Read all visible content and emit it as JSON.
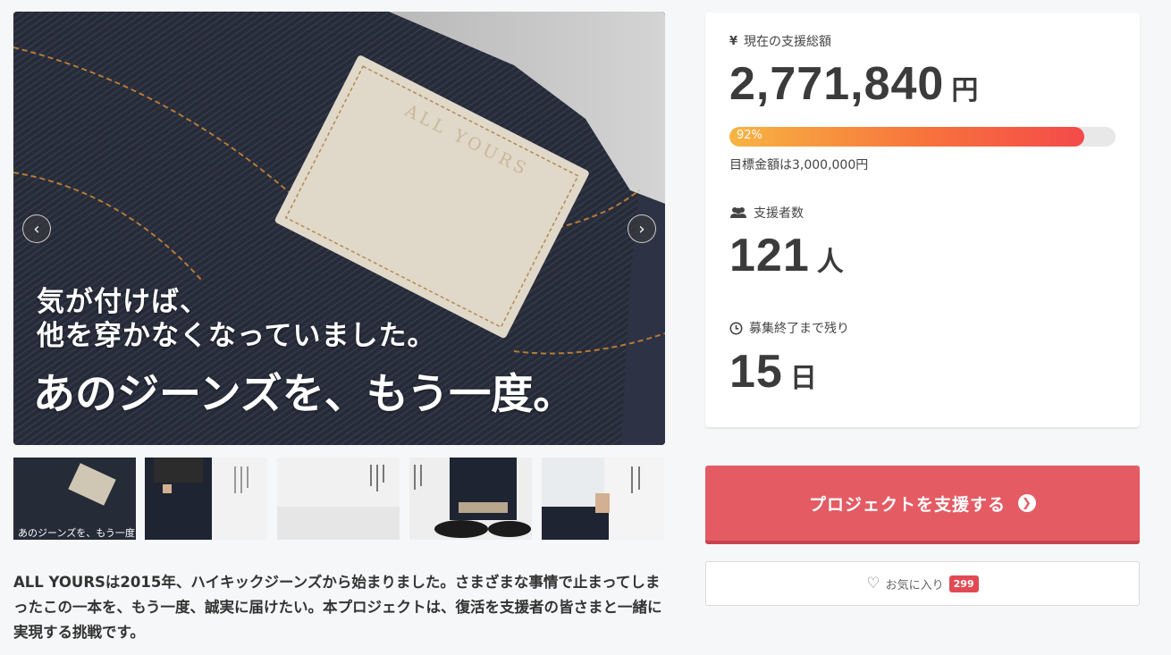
{
  "hero": {
    "patch_text": "ALL YOURS",
    "line1": "気が付けば、",
    "line2": "他を穿かなくなっていました。",
    "headline": "あのジーンズを、もう一度。",
    "prev_icon": "chevron-left-icon",
    "next_icon": "chevron-right-icon"
  },
  "thumbnails": [
    {
      "caption": "あのジーンズを、もう一度"
    },
    {
      "caption": ""
    },
    {
      "caption": ""
    },
    {
      "caption": ""
    },
    {
      "caption": ""
    }
  ],
  "description": "ALL YOURSは2015年、ハイキックジーンズから始まりました。さまざまな事情で止まってしまったこの一本を、もう一度、誠実に届けたい。本プロジェクトは、復活を支援者の皆さまと一緒に実現する挑戦です。",
  "stats": {
    "total_label": "現在の支援総額",
    "total_icon": "yen-icon",
    "total_value": "2,771,840",
    "total_unit": "円",
    "progress_percent": 92,
    "progress_text": "92%",
    "goal_text": "目標金額は3,000,000円",
    "backers_label": "支援者数",
    "backers_icon": "users-icon",
    "backers_value": "121",
    "backers_unit": "人",
    "remaining_label": "募集終了まで残り",
    "remaining_icon": "clock-icon",
    "remaining_value": "15",
    "remaining_unit": "日"
  },
  "actions": {
    "support_label": "プロジェクトを支援する",
    "support_icon": "arrow-circle-right-icon",
    "favorite_label": "お気に入り",
    "favorite_icon": "heart-icon",
    "favorite_count": "299"
  },
  "colors": {
    "accent": "#e45b64",
    "progress_start": "#f7b442",
    "progress_end": "#f44a4a",
    "badge": "#e14a55"
  }
}
